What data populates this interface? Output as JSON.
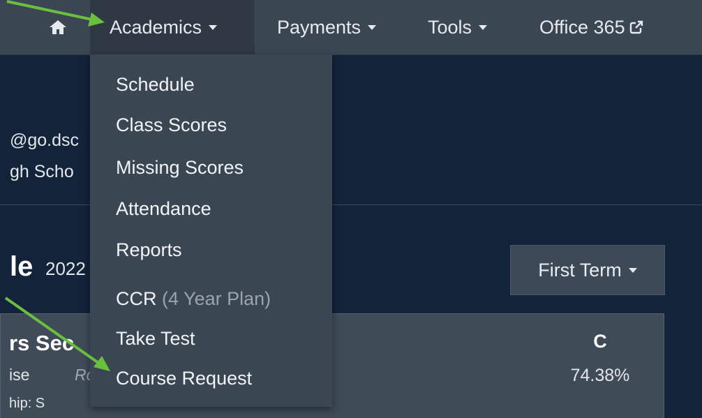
{
  "nav": {
    "home_icon": "home-icon",
    "academics": "Academics",
    "payments": "Payments",
    "tools": "Tools",
    "office": "Office 365",
    "external_icon": "external-link-icon"
  },
  "academics_menu": {
    "items": [
      "Schedule",
      "Class Scores",
      "Missing Scores",
      "Attendance",
      "Reports",
      "CCR",
      "Take Test",
      "Course Request"
    ],
    "ccr_suffix": "(4 Year Plan)"
  },
  "profile": {
    "email_fragment": "@go.dsc",
    "school_fragment": "gh Scho"
  },
  "schedule": {
    "title_fragment": "le",
    "year_fragment": "2022",
    "term_button": "First Term"
  },
  "course": {
    "name_fragment": "rs Sec",
    "line2a": "ise",
    "line2b": "Rc",
    "line3": "hip: S",
    "grade_letter": "C",
    "grade_percent": "74.38%"
  },
  "annotations": {
    "arrow_color": "#6abf3f"
  }
}
